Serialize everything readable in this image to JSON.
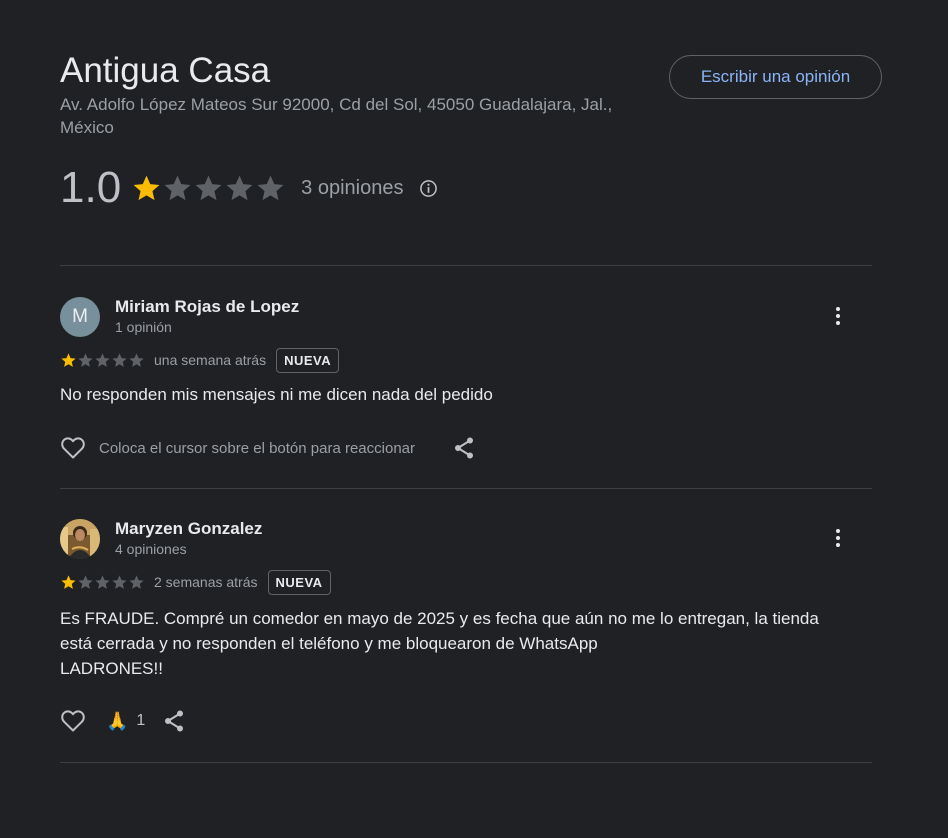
{
  "place": {
    "name": "Antigua Casa",
    "address": "Av. Adolfo López Mateos Sur 92000, Cd del Sol, 45050 Guadalajara, Jal., México"
  },
  "actions": {
    "write_review_label": "Escribir una opinión"
  },
  "rating_summary": {
    "value": "1.0",
    "stars_filled": 1,
    "stars_total": 5,
    "count_label": "3 opiniones",
    "info_icon": "info-icon"
  },
  "reviews": [
    {
      "avatar_letter": "M",
      "avatar_color": "#78909c",
      "name": "Miriam Rojas de Lopez",
      "meta": "1 opinión",
      "stars_filled": 1,
      "stars_total": 5,
      "date": "una semana atrás",
      "badge": "NUEVA",
      "text": "No responden mis mensajes ni me dicen nada del pedido",
      "react_hint": "Coloca el cursor sobre el botón para reaccionar"
    },
    {
      "avatar_letter": "",
      "name": "Maryzen Gonzalez",
      "meta": "4 opiniones",
      "stars_filled": 1,
      "stars_total": 5,
      "date": "2 semanas atrás",
      "badge": "NUEVA",
      "text_lines": [
        "Es FRAUDE. Compré un comedor en mayo de 2025 y es fecha que aún no me lo entregan, la tienda",
        "está cerrada y no responden el teléfono y me bloquearon de WhatsApp",
        "LADRONES!!"
      ],
      "reaction_emoji": "🙏",
      "reaction_count": "1"
    }
  ],
  "colors": {
    "background": "#202124",
    "star_filled": "#fbbc04",
    "star_empty": "#5f6368",
    "link_blue": "#8ab4f8"
  }
}
